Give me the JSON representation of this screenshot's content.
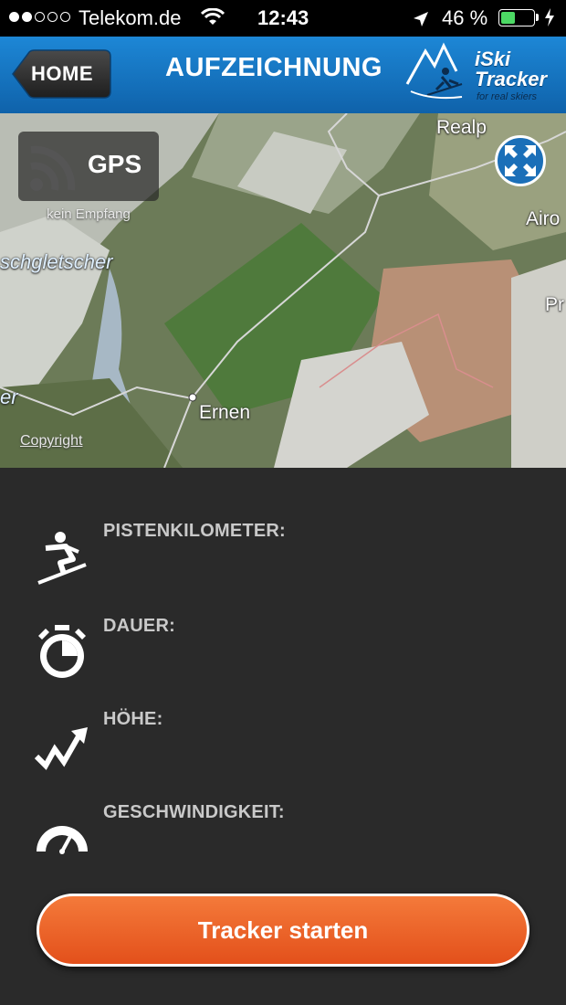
{
  "status_bar": {
    "carrier": "Telekom.de",
    "signal_bars_filled": 2,
    "signal_bars_total": 5,
    "time": "12:43",
    "battery_text": "46 %",
    "battery_level": 0.46,
    "battery_color": "#4cd964"
  },
  "navbar": {
    "home_label": "HOME",
    "title": "AUFZEICHNUNG",
    "logo": {
      "name_line1": "iSki",
      "name_line2": "Tracker",
      "tagline": "for real skiers"
    },
    "color": "#1478c4"
  },
  "map": {
    "gps_label": "GPS",
    "gps_status": "kein Empfang",
    "places": [
      "Realp",
      "Airo",
      "Pr",
      "Ernen",
      "schgletscher",
      "er"
    ],
    "copyright": "Copyright",
    "expand_icon": "expand-arrows-icon"
  },
  "stats": [
    {
      "label": "PISTENKILOMETER:",
      "icon": "skier-icon"
    },
    {
      "label": "DAUER:",
      "icon": "stopwatch-icon"
    },
    {
      "label": "HÖHE:",
      "icon": "altitude-trend-icon"
    },
    {
      "label": "GESCHWINDIGKEIT:",
      "icon": "speedometer-icon"
    }
  ],
  "start_button": {
    "label": "Tracker starten",
    "color": "#e85a22"
  }
}
